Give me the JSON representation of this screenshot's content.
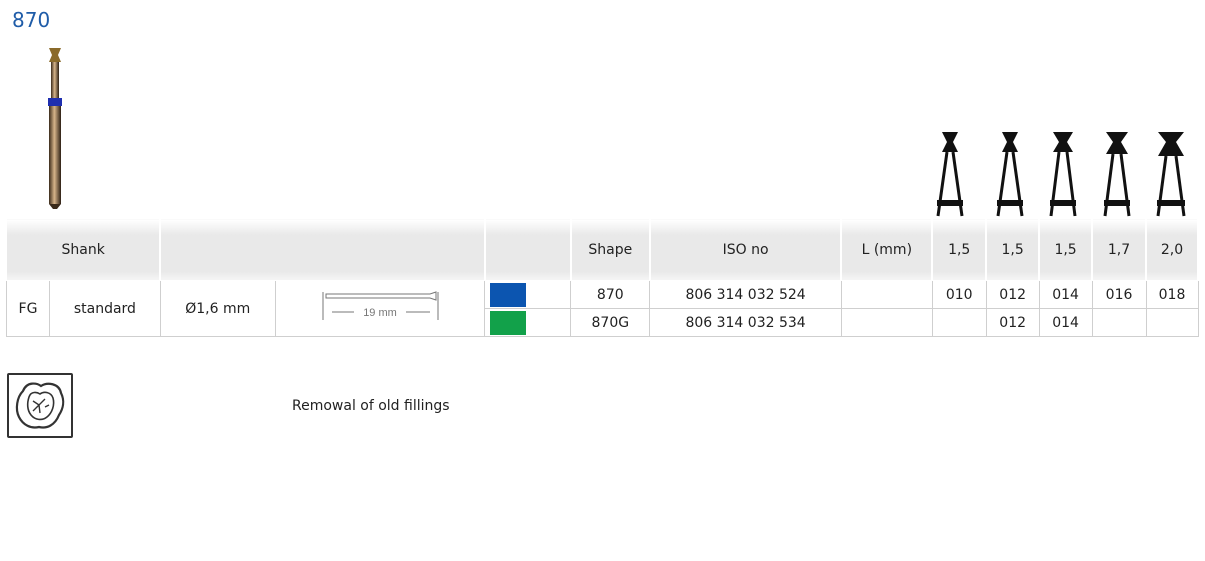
{
  "product": {
    "code": "870"
  },
  "colors": {
    "accent": "#1f5ca8",
    "blue_ring": "#0c55b0",
    "green_ring": "#12a14a"
  },
  "table": {
    "header": {
      "shank": "Shank",
      "shape": "Shape",
      "iso": "ISO no",
      "length": "L (mm)",
      "sizes": [
        "1,5",
        "1,5",
        "1,5",
        "1,7",
        "2,0"
      ]
    },
    "shank_type": "FG",
    "shank_variant": "standard",
    "diameter": "Ø1,6 mm",
    "shank_length_label": "19 mm",
    "rows": [
      {
        "swatch": "blue",
        "shape": "870",
        "iso": "806 314 032 524",
        "length": "",
        "sizes": [
          "010",
          "012",
          "014",
          "016",
          "018"
        ]
      },
      {
        "swatch": "green",
        "shape": "870G",
        "iso": "806 314 032 534",
        "length": "",
        "sizes": [
          "",
          "012",
          "014",
          "",
          ""
        ]
      }
    ]
  },
  "indication": {
    "icon": "tooth-filling-icon",
    "text": "Remowal of old fillings"
  }
}
